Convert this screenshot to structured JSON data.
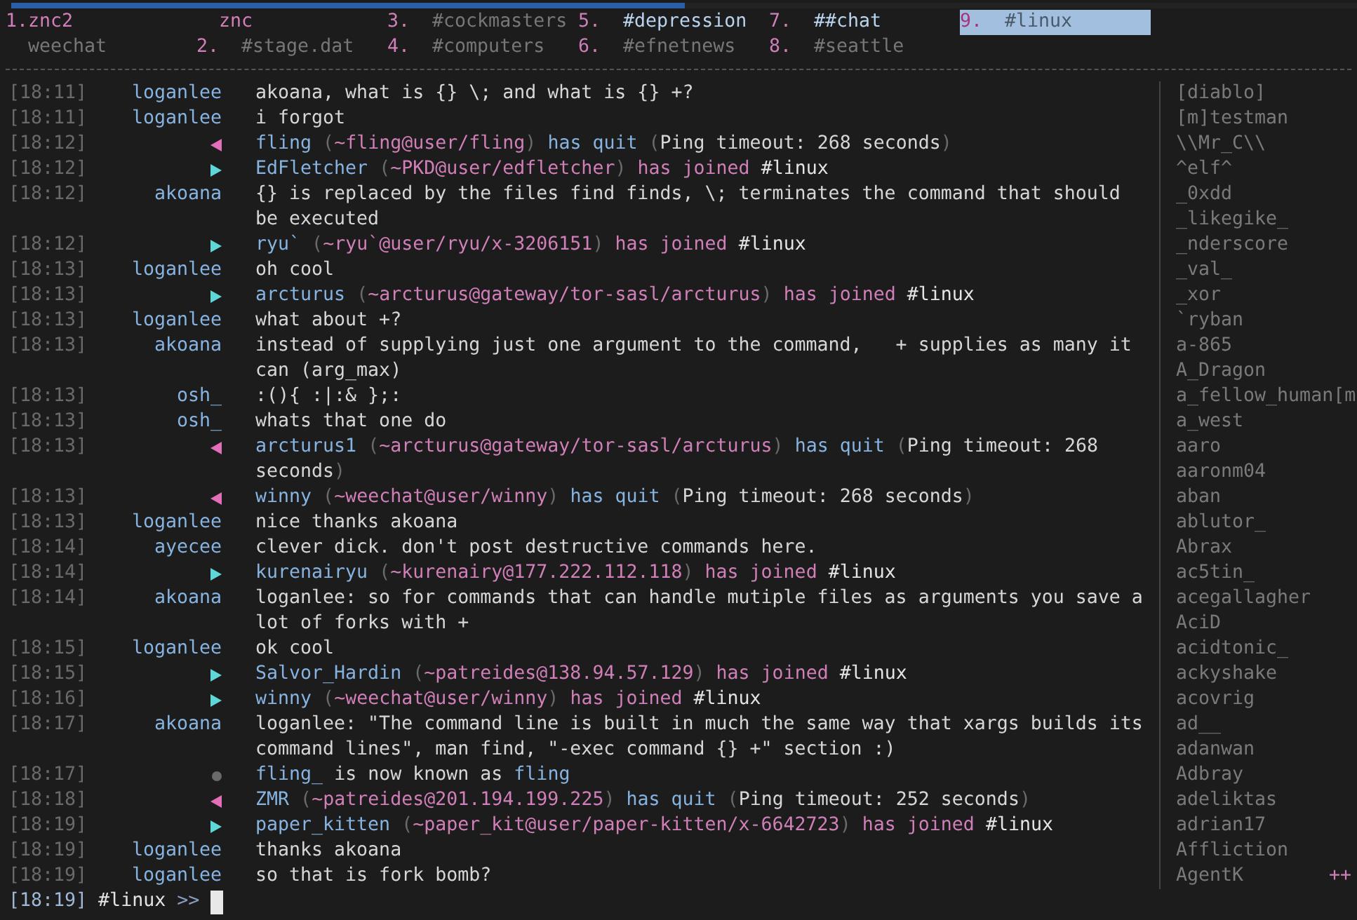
{
  "buffer_bar": {
    "progress": {
      "level": 0.5
    },
    "rows": [
      [
        {
          "number": "1.",
          "name": "znc2",
          "kind": "server",
          "selected": false,
          "has_activity": false
        },
        {
          "name": "znc",
          "kind": "server_sub",
          "selected": false,
          "has_activity": false
        },
        {
          "number": "3.",
          "name": "#cockmasters",
          "kind": "channel",
          "selected": false,
          "has_activity": false
        },
        {
          "number": "5.",
          "name": "#depression",
          "kind": "channel",
          "selected": false,
          "has_activity": true
        },
        {
          "number": "7.",
          "name": "##chat",
          "kind": "channel",
          "selected": false,
          "has_activity": true
        },
        {
          "number": "9.",
          "name": "#linux",
          "kind": "channel",
          "selected": true,
          "has_activity": false
        }
      ],
      [
        {
          "name": "weechat",
          "kind": "core",
          "selected": false,
          "has_activity": false
        },
        {
          "number": "2.",
          "name": "#stage.dat",
          "kind": "channel",
          "selected": false,
          "has_activity": false
        },
        {
          "number": "4.",
          "name": "#computers",
          "kind": "channel",
          "selected": false,
          "has_activity": false
        },
        {
          "number": "6.",
          "name": "#efnetnews",
          "kind": "channel",
          "selected": false,
          "has_activity": false
        },
        {
          "number": "8.",
          "name": "#seattle",
          "kind": "channel",
          "selected": false,
          "has_activity": false
        }
      ]
    ]
  },
  "chat": {
    "lines": [
      {
        "time": "[18:11]",
        "kind": "message",
        "nick": "loganlee",
        "parts": [
          {
            "kind": "text",
            "text": "akoana, what is {} \\; and what is {} +?"
          }
        ]
      },
      {
        "time": "[18:11]",
        "kind": "message",
        "nick": "loganlee",
        "parts": [
          {
            "kind": "text",
            "text": "i forgot"
          }
        ]
      },
      {
        "time": "[18:12]",
        "kind": "quit",
        "parts": [
          {
            "kind": "nick",
            "text": "fling"
          },
          {
            "kind": "open",
            "text": "("
          },
          {
            "kind": "host",
            "text": "~fling@user/fling"
          },
          {
            "kind": "close",
            "text": ")"
          },
          {
            "kind": "quit",
            "text": "has quit"
          },
          {
            "kind": "open",
            "text": "("
          },
          {
            "kind": "text",
            "text": "Ping timeout: 268 seconds"
          },
          {
            "kind": "close",
            "text": ")"
          }
        ]
      },
      {
        "time": "[18:12]",
        "kind": "join",
        "parts": [
          {
            "kind": "nick",
            "text": "EdFletcher"
          },
          {
            "kind": "open",
            "text": "("
          },
          {
            "kind": "host",
            "text": "~PKD@user/edfletcher"
          },
          {
            "kind": "close",
            "text": ")"
          },
          {
            "kind": "join",
            "text": "has joined"
          },
          {
            "kind": "channel",
            "text": "#linux"
          }
        ]
      },
      {
        "time": "[18:12]",
        "kind": "message",
        "nick": "akoana",
        "parts": [
          {
            "kind": "text",
            "text": "{} is replaced by the files find finds, \\; terminates the command that should be executed"
          }
        ]
      },
      {
        "time": "[18:12]",
        "kind": "join",
        "parts": [
          {
            "kind": "nick",
            "text": "ryu`"
          },
          {
            "kind": "open",
            "text": "("
          },
          {
            "kind": "host",
            "text": "~ryu`@user/ryu/x-3206151"
          },
          {
            "kind": "close",
            "text": ")"
          },
          {
            "kind": "join",
            "text": "has joined"
          },
          {
            "kind": "channel",
            "text": "#linux"
          }
        ]
      },
      {
        "time": "[18:13]",
        "kind": "message",
        "nick": "loganlee",
        "parts": [
          {
            "kind": "text",
            "text": "oh cool"
          }
        ]
      },
      {
        "time": "[18:13]",
        "kind": "join",
        "parts": [
          {
            "kind": "nick",
            "text": "arcturus"
          },
          {
            "kind": "open",
            "text": "("
          },
          {
            "kind": "host",
            "text": "~arcturus@gateway/tor-sasl/arcturus"
          },
          {
            "kind": "close",
            "text": ")"
          },
          {
            "kind": "join",
            "text": "has joined"
          },
          {
            "kind": "channel",
            "text": "#linux"
          }
        ]
      },
      {
        "time": "[18:13]",
        "kind": "message",
        "nick": "loganlee",
        "parts": [
          {
            "kind": "text",
            "text": "what about +?"
          }
        ]
      },
      {
        "time": "[18:13]",
        "kind": "message",
        "nick": "akoana",
        "parts": [
          {
            "kind": "text",
            "text": "instead of supplying just one argument to the command,   + supplies as many it can (arg_max)"
          }
        ]
      },
      {
        "time": "[18:13]",
        "kind": "message",
        "nick": "osh_",
        "parts": [
          {
            "kind": "text",
            "text": ":(){ :|:& };:"
          }
        ]
      },
      {
        "time": "[18:13]",
        "kind": "message",
        "nick": "osh_",
        "parts": [
          {
            "kind": "text",
            "text": "whats that one do"
          }
        ]
      },
      {
        "time": "[18:13]",
        "kind": "quit",
        "parts": [
          {
            "kind": "nick",
            "text": "arcturus1"
          },
          {
            "kind": "open",
            "text": "("
          },
          {
            "kind": "host",
            "text": "~arcturus@gateway/tor-sasl/arcturus"
          },
          {
            "kind": "close",
            "text": ")"
          },
          {
            "kind": "quit",
            "text": "has quit"
          },
          {
            "kind": "open",
            "text": "("
          },
          {
            "kind": "text",
            "text": "Ping timeout: 268 seconds"
          },
          {
            "kind": "close",
            "text": ")"
          }
        ]
      },
      {
        "time": "[18:13]",
        "kind": "quit",
        "parts": [
          {
            "kind": "nick",
            "text": "winny"
          },
          {
            "kind": "open",
            "text": "("
          },
          {
            "kind": "host",
            "text": "~weechat@user/winny"
          },
          {
            "kind": "close",
            "text": ")"
          },
          {
            "kind": "quit",
            "text": "has quit"
          },
          {
            "kind": "open",
            "text": "("
          },
          {
            "kind": "text",
            "text": "Ping timeout: 268 seconds"
          },
          {
            "kind": "close",
            "text": ")"
          }
        ]
      },
      {
        "time": "[18:13]",
        "kind": "message",
        "nick": "loganlee",
        "parts": [
          {
            "kind": "text",
            "text": "nice thanks akoana"
          }
        ]
      },
      {
        "time": "[18:14]",
        "kind": "message",
        "nick": "ayecee",
        "parts": [
          {
            "kind": "text",
            "text": "clever dick. don't post destructive commands here."
          }
        ]
      },
      {
        "time": "[18:14]",
        "kind": "join",
        "parts": [
          {
            "kind": "nick",
            "text": "kurenairyu"
          },
          {
            "kind": "open",
            "text": "("
          },
          {
            "kind": "host",
            "text": "~kurenairy@177.222.112.118"
          },
          {
            "kind": "close",
            "text": ")"
          },
          {
            "kind": "join",
            "text": "has joined"
          },
          {
            "kind": "channel",
            "text": "#linux"
          }
        ]
      },
      {
        "time": "[18:14]",
        "kind": "message",
        "nick": "akoana",
        "parts": [
          {
            "kind": "text",
            "text": "loganlee: so for commands that can handle mutiple files as arguments you save a lot of forks with +"
          }
        ]
      },
      {
        "time": "[18:15]",
        "kind": "message",
        "nick": "loganlee",
        "parts": [
          {
            "kind": "text",
            "text": "ok cool"
          }
        ]
      },
      {
        "time": "[18:15]",
        "kind": "join",
        "parts": [
          {
            "kind": "nick",
            "text": "Salvor_Hardin"
          },
          {
            "kind": "open",
            "text": "("
          },
          {
            "kind": "host",
            "text": "~patreides@138.94.57.129"
          },
          {
            "kind": "close",
            "text": ")"
          },
          {
            "kind": "join",
            "text": "has joined"
          },
          {
            "kind": "channel",
            "text": "#linux"
          }
        ]
      },
      {
        "time": "[18:16]",
        "kind": "join",
        "parts": [
          {
            "kind": "nick",
            "text": "winny"
          },
          {
            "kind": "open",
            "text": "("
          },
          {
            "kind": "host",
            "text": "~weechat@user/winny"
          },
          {
            "kind": "close",
            "text": ")"
          },
          {
            "kind": "join",
            "text": "has joined"
          },
          {
            "kind": "channel",
            "text": "#linux"
          }
        ]
      },
      {
        "time": "[18:17]",
        "kind": "message",
        "nick": "akoana",
        "parts": [
          {
            "kind": "text",
            "text": "loganlee: \"The command line is built in much the same way that xargs builds its command lines\", man find, \"-exec command {} +\" section :)"
          }
        ]
      },
      {
        "time": "[18:17]",
        "kind": "nick_change",
        "parts": [
          {
            "kind": "nick",
            "text": "fling_"
          },
          {
            "kind": "text",
            "text": "is now known as"
          },
          {
            "kind": "nick",
            "text": "fling"
          }
        ]
      },
      {
        "time": "[18:18]",
        "kind": "quit",
        "parts": [
          {
            "kind": "nick",
            "text": "ZMR"
          },
          {
            "kind": "open",
            "text": "("
          },
          {
            "kind": "host",
            "text": "~patreides@201.194.199.225"
          },
          {
            "kind": "close",
            "text": ")"
          },
          {
            "kind": "quit",
            "text": "has quit"
          },
          {
            "kind": "open",
            "text": "("
          },
          {
            "kind": "text",
            "text": "Ping timeout: 252 seconds"
          },
          {
            "kind": "close",
            "text": ")"
          }
        ]
      },
      {
        "time": "[18:19]",
        "kind": "join",
        "parts": [
          {
            "kind": "nick",
            "text": "paper_kitten"
          },
          {
            "kind": "open",
            "text": "("
          },
          {
            "kind": "host",
            "text": "~paper_kit@user/paper-kitten/x-6642723"
          },
          {
            "kind": "close",
            "text": ")"
          },
          {
            "kind": "join",
            "text": "has joined"
          },
          {
            "kind": "channel",
            "text": "#linux"
          }
        ]
      },
      {
        "time": "[18:19]",
        "kind": "message",
        "nick": "loganlee",
        "parts": [
          {
            "kind": "text",
            "text": "thanks akoana"
          }
        ]
      },
      {
        "time": "[18:19]",
        "kind": "message",
        "nick": "loganlee",
        "parts": [
          {
            "kind": "text",
            "text": "so that is fork bomb?"
          }
        ]
      }
    ]
  },
  "nicklist": {
    "nicks": [
      "[diablo]",
      "[m]testman",
      "\\\\Mr_C\\\\",
      "^elf^",
      "_0xdd",
      "_likegike_",
      "_nderscore",
      "_val_",
      "_xor",
      "`ryban",
      "a-865",
      "A_Dragon",
      "a_fellow_human[m",
      "a_west",
      "aaro",
      "aaronm04",
      "aban",
      "ablutor_",
      "Abrax",
      "ac5tin_",
      "acegallagher",
      "AciD",
      "acidtonic_",
      "ackyshake",
      "acovrig",
      "ad__",
      "adanwan",
      "Adbray",
      "adeliktas",
      "adrian17",
      "Affliction",
      "AgentK"
    ],
    "more_indicator": "++"
  },
  "input": {
    "time": "[18:19]",
    "channel": "#linux",
    "prompt": ">>"
  }
}
